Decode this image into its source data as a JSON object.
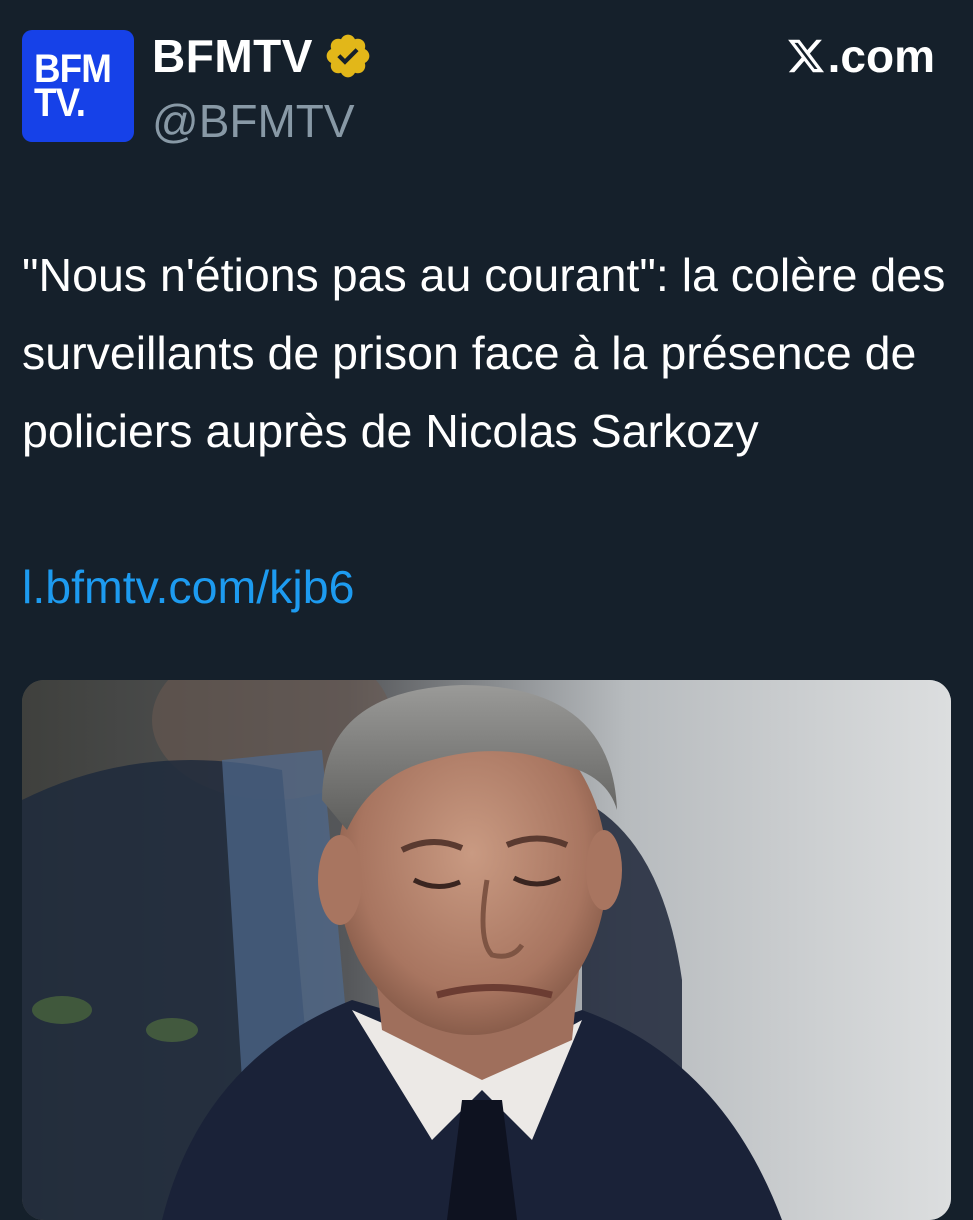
{
  "account": {
    "avatar_line1": "BFM",
    "avatar_line2": "TV.",
    "display_name": "BFMTV",
    "handle": "@BFMTV",
    "verified_icon": "gold-verified-badge-icon",
    "verified_color": "#e2b719"
  },
  "brand": {
    "icon": "x-logo-icon",
    "domain": ".com"
  },
  "tweet": {
    "text": "\"Nous n'étions pas au courant\": la colère des surveillants de prison face à la présence de policiers auprès de Nicolas Sarkozy",
    "link": "l.bfmtv.com/kjb6"
  },
  "colors": {
    "background": "#15202b",
    "avatar_blue": "#1641e8",
    "link_blue": "#1d9bf0",
    "handle_gray": "#8899a6"
  }
}
